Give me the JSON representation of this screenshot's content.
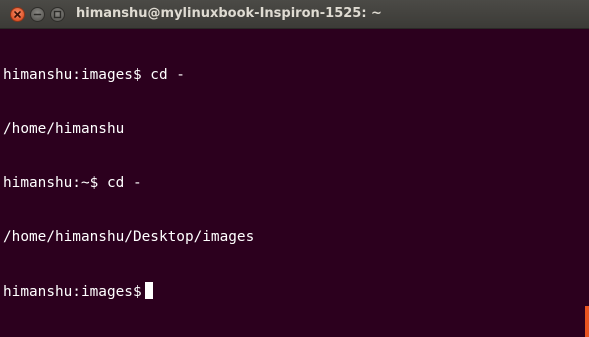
{
  "window": {
    "title": "himanshu@mylinuxbook-Inspiron-1525: ~"
  },
  "icons": {
    "close": "close-icon",
    "minimize": "minimize-icon",
    "maximize": "maximize-icon"
  },
  "colors": {
    "terminal_background": "#2c001e",
    "terminal_text": "#ffffff",
    "titlebar": "#3c3b37",
    "close_button": "#e0552a",
    "accent": "#e95420"
  },
  "terminal": {
    "lines": [
      "himanshu:images$ cd -",
      "/home/himanshu",
      "himanshu:~$ cd -",
      "/home/himanshu/Desktop/images"
    ],
    "prompt": "himanshu:images$"
  }
}
